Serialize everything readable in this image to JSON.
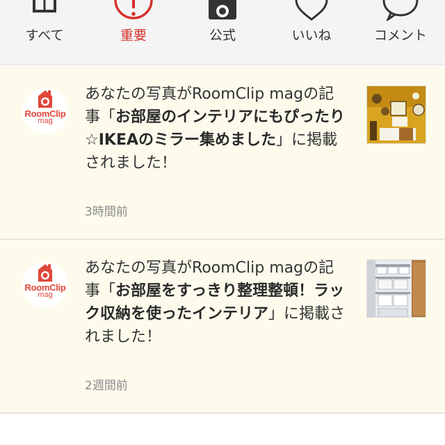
{
  "tabs": [
    {
      "label": "すべて",
      "icon": "inbox-icon",
      "active": false
    },
    {
      "label": "重要",
      "icon": "alert-icon",
      "active": true
    },
    {
      "label": "公式",
      "icon": "camera-icon",
      "active": false
    },
    {
      "label": "いいね",
      "icon": "heart-icon",
      "active": false
    },
    {
      "label": "コメント",
      "icon": "speech-bubble-icon",
      "active": false
    }
  ],
  "colors": {
    "accent": "#d6312a",
    "notification_bg": "#fdfbec",
    "logo": "#e0473a"
  },
  "avatar": {
    "logo_text": "RoomClip",
    "logo_sub": "mag"
  },
  "notifications": [
    {
      "prefix": "あなたの写真がRoomClip magの記事「",
      "title": "お部屋のインテリアにもぴったり☆IKEAのミラー集めました",
      "suffix": "」に掲載されました！",
      "time": "3時間前",
      "thumb": "yellow-room-mirrors-photo"
    },
    {
      "prefix": "あなたの写真がRoomClip magの記事「",
      "title": "お部屋をすっきり整理整頓！ラック収納を使ったインテリア",
      "suffix": "」に掲載されました！",
      "time": "2週間前",
      "thumb": "storage-rack-photo"
    }
  ]
}
